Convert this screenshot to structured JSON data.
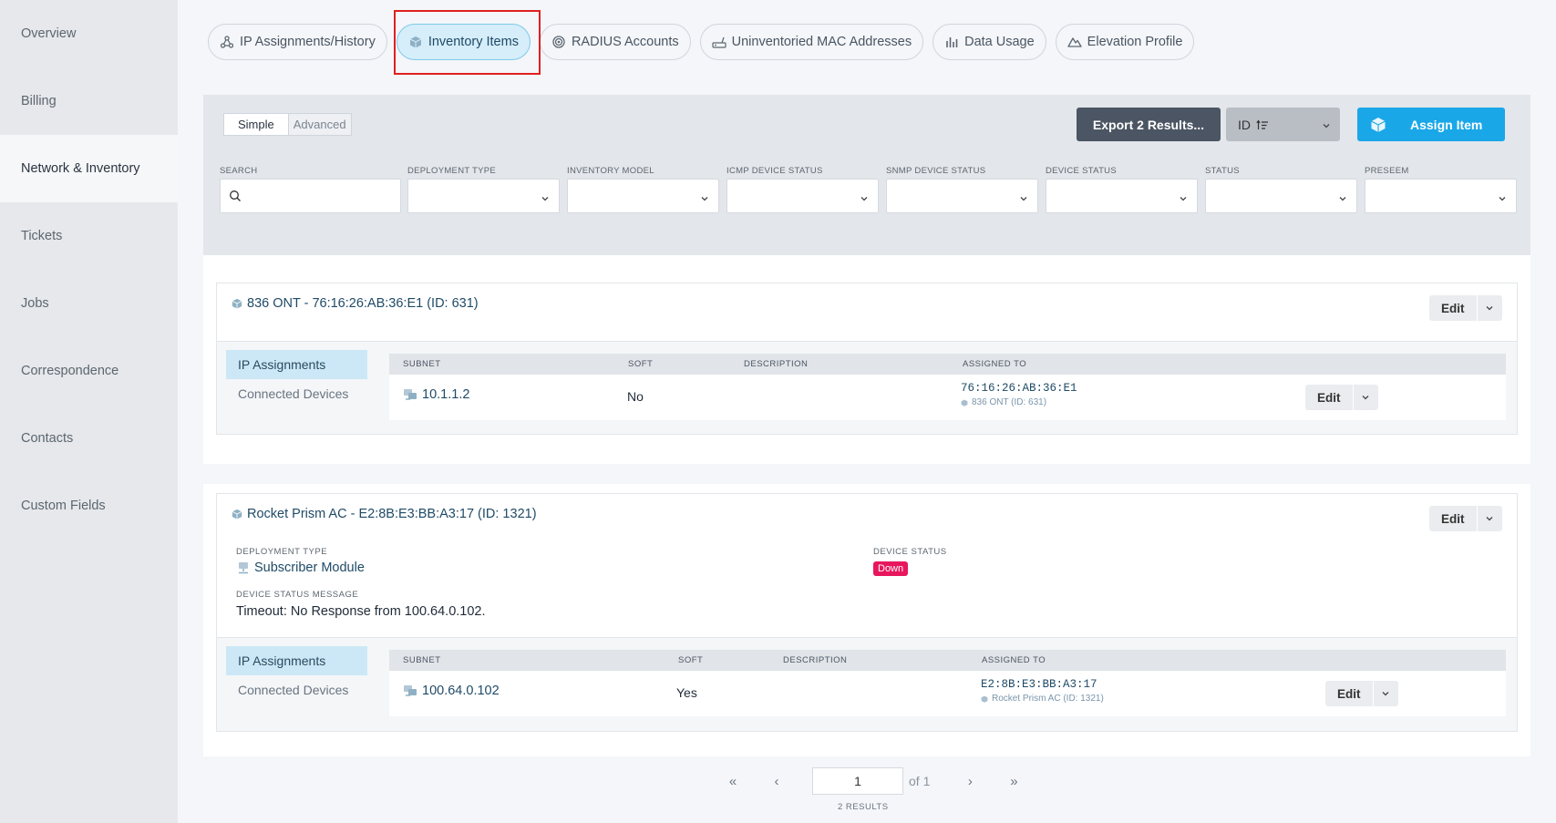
{
  "sidebar": {
    "items": [
      {
        "label": "Overview"
      },
      {
        "label": "Billing"
      },
      {
        "label": "Network & Inventory"
      },
      {
        "label": "Tickets"
      },
      {
        "label": "Jobs"
      },
      {
        "label": "Correspondence"
      },
      {
        "label": "Contacts"
      },
      {
        "label": "Custom Fields"
      }
    ],
    "active_index": 2
  },
  "tabs": [
    {
      "label": "IP Assignments/History",
      "icon": "network-icon"
    },
    {
      "label": "Inventory Items",
      "icon": "cube-icon",
      "active": true
    },
    {
      "label": "RADIUS Accounts",
      "icon": "radius-icon"
    },
    {
      "label": "Uninventoried MAC Addresses",
      "icon": "router-icon"
    },
    {
      "label": "Data Usage",
      "icon": "bar-chart-icon"
    },
    {
      "label": "Elevation Profile",
      "icon": "mountain-icon"
    }
  ],
  "filter_panel": {
    "mode_simple": "Simple",
    "mode_advanced": "Advanced",
    "export_label": "Export 2 Results...",
    "sort_label": "ID",
    "assign_label": "Assign Item",
    "filters": [
      {
        "label": "SEARCH"
      },
      {
        "label": "DEPLOYMENT TYPE"
      },
      {
        "label": "INVENTORY MODEL"
      },
      {
        "label": "ICMP DEVICE STATUS"
      },
      {
        "label": "SNMP DEVICE STATUS"
      },
      {
        "label": "DEVICE STATUS"
      },
      {
        "label": "STATUS"
      },
      {
        "label": "PRESEEM"
      }
    ]
  },
  "items": [
    {
      "title": "836 ONT - 76:16:26:AB:36:E1 (ID: 631)",
      "edit_label": "Edit",
      "subnav": [
        "IP Assignments",
        "Connected Devices"
      ],
      "columns": [
        "SUBNET",
        "SOFT",
        "DESCRIPTION",
        "ASSIGNED TO"
      ],
      "row": {
        "subnet": "10.1.1.2",
        "soft": "No",
        "description": "",
        "assigned_mac": "76:16:26:AB:36:E1",
        "assigned_sub": "836 ONT (ID: 631)",
        "edit_label": "Edit"
      }
    },
    {
      "title": "Rocket Prism AC - E2:8B:E3:BB:A3:17 (ID: 1321)",
      "edit_label": "Edit",
      "deployment_type_label": "DEPLOYMENT TYPE",
      "deployment_type": "Subscriber Module",
      "device_status_label": "DEVICE STATUS",
      "device_status": "Down",
      "device_status_message_label": "DEVICE STATUS MESSAGE",
      "device_status_message": "Timeout: No Response from 100.64.0.102.",
      "subnav": [
        "IP Assignments",
        "Connected Devices"
      ],
      "columns": [
        "SUBNET",
        "SOFT",
        "DESCRIPTION",
        "ASSIGNED TO"
      ],
      "row": {
        "subnet": "100.64.0.102",
        "soft": "Yes",
        "description": "",
        "assigned_mac": "E2:8B:E3:BB:A3:17",
        "assigned_sub": "Rocket Prism AC (ID: 1321)",
        "edit_label": "Edit"
      }
    }
  ],
  "pagination": {
    "first": "«",
    "prev": "‹",
    "page": "1",
    "of": "of 1",
    "next": "›",
    "last": "»",
    "results": "2 RESULTS"
  },
  "colors": {
    "accent": "#1aa7e8",
    "active_tab_bg": "#d6eefa",
    "badge_down": "#e8175d",
    "highlight": "#e02020"
  }
}
